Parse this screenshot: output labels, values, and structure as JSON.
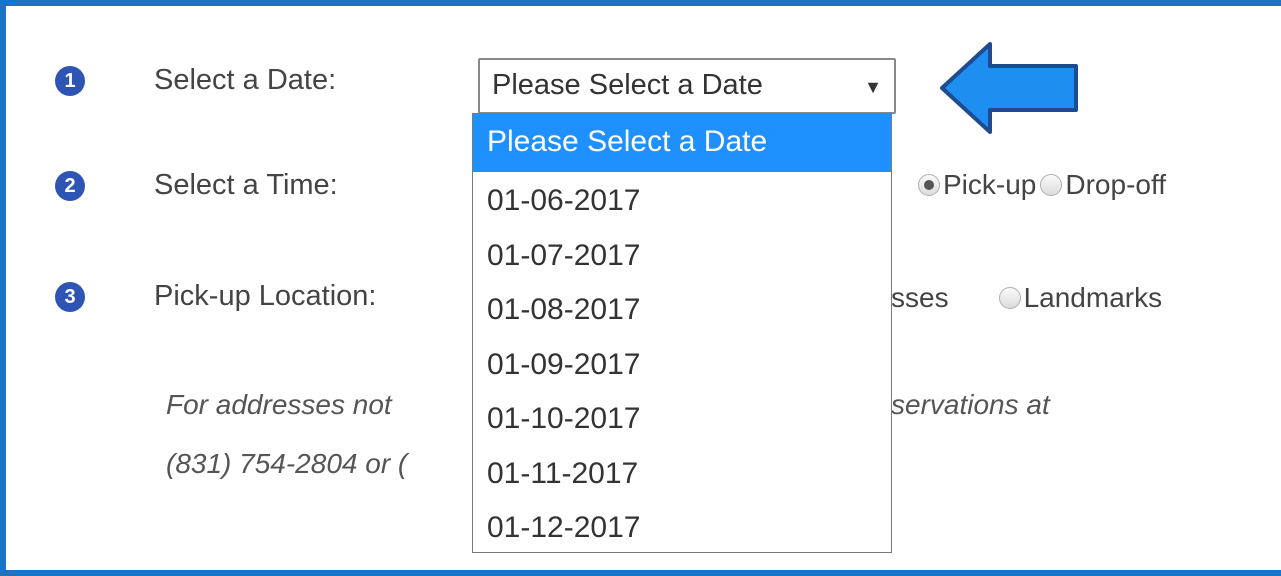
{
  "steps": [
    {
      "number": "1",
      "label": "Select a Date:"
    },
    {
      "number": "2",
      "label": "Select a Time:"
    },
    {
      "number": "3",
      "label": "Pick-up Location:"
    }
  ],
  "date_select": {
    "value": "Please Select a Date",
    "options": [
      "Please Select a Date",
      "01-06-2017",
      "01-07-2017",
      "01-08-2017",
      "01-09-2017",
      "01-10-2017",
      "01-11-2017",
      "01-12-2017"
    ],
    "highlighted_index": 0
  },
  "trip_type": {
    "options": [
      "Pick-up",
      "Drop-off"
    ],
    "selected": "Pick-up"
  },
  "location_type": {
    "partial_option": "sses",
    "landmarks_label": "Landmarks"
  },
  "note": {
    "line1_left": "For addresses not",
    "line1_right": "servations at",
    "line2_left": "(831) 754-2804 or ("
  },
  "colors": {
    "frame": "#1a73c7",
    "step_badge": "#2f55b4",
    "highlight": "#1e90ff",
    "arrow_fill": "#1e8ff0",
    "arrow_stroke": "#1f4c8f"
  }
}
